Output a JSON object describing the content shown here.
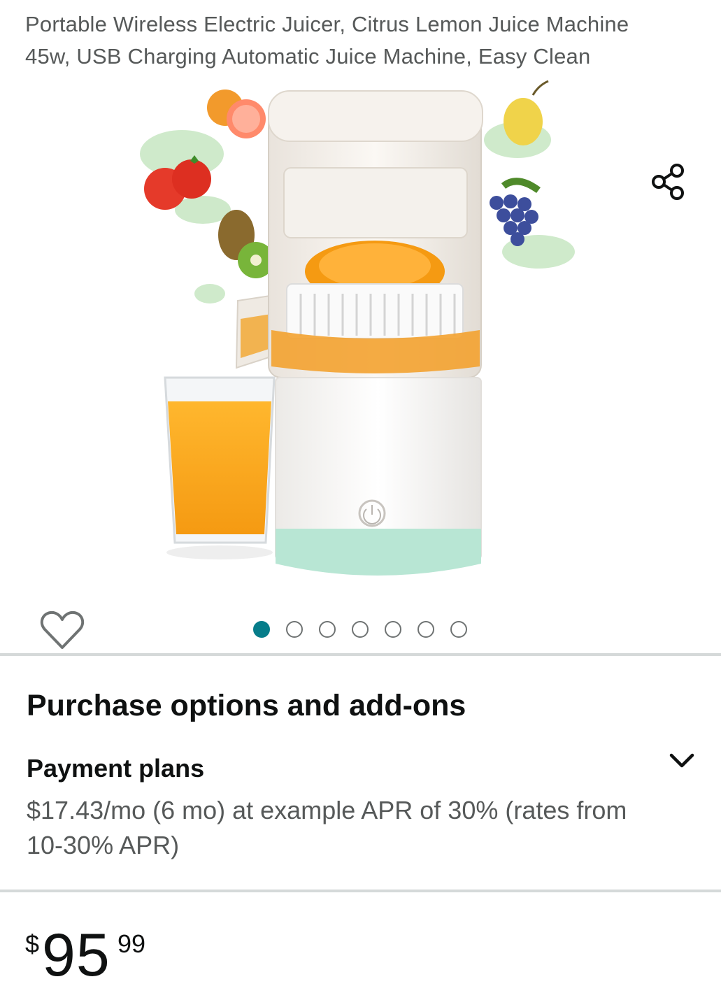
{
  "product": {
    "title": "Portable Wireless Electric Juicer, Citrus Lemon Juice Machine 45w, USB Charging Automatic Juice Machine, Easy Clean"
  },
  "gallery": {
    "image_count": 7,
    "active_index": 0,
    "share_icon": "share-icon",
    "wishlist_icon": "heart-icon"
  },
  "purchase_options": {
    "heading": "Purchase options and add-ons",
    "payment_plans": {
      "label": "Payment plans",
      "description": "$17.43/mo (6 mo) at example APR of 30% (rates from 10-30% APR)",
      "expand_icon": "chevron-down-icon"
    }
  },
  "price": {
    "symbol": "$",
    "whole": "95",
    "fraction": "99"
  },
  "colors": {
    "active_dot": "#067d8a",
    "divider": "#d5d9d9",
    "secondary_text": "#565959"
  }
}
